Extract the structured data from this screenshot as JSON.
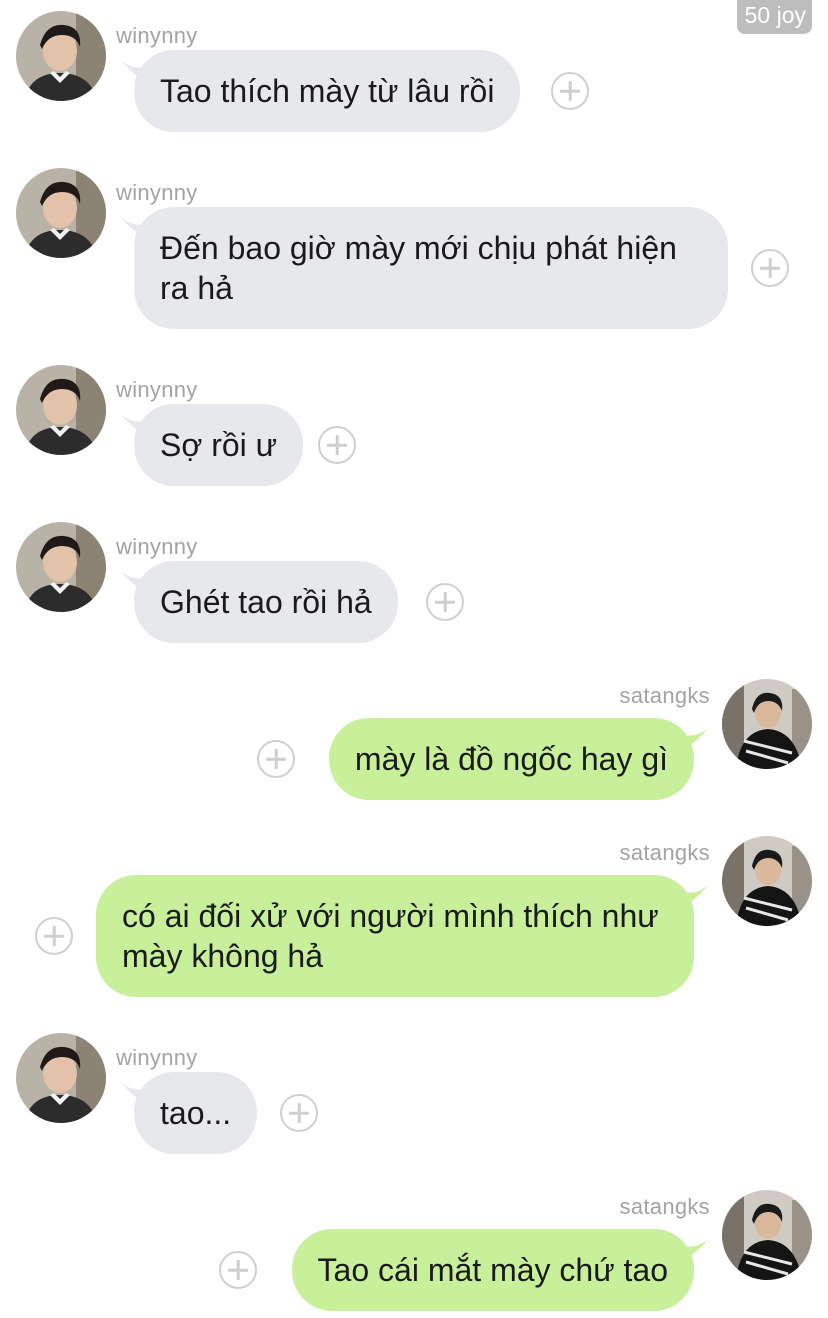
{
  "header": {
    "badge": "50 joy"
  },
  "users": {
    "left": {
      "name": "winynny",
      "avatar": "avatar-winynny"
    },
    "right": {
      "name": "satangks",
      "avatar": "avatar-satangks"
    }
  },
  "messages": [
    {
      "sender": "winynny",
      "side": "left",
      "text": "Tao thích mày từ lâu rồi"
    },
    {
      "sender": "winynny",
      "side": "left",
      "text": "Đến bao giờ mày mới chịu phát hiện ra hả"
    },
    {
      "sender": "winynny",
      "side": "left",
      "text": "Sợ rồi ư"
    },
    {
      "sender": "winynny",
      "side": "left",
      "text": "Ghét tao rồi hả"
    },
    {
      "sender": "satangks",
      "side": "right",
      "text": "mày là đồ ngốc hay gì"
    },
    {
      "sender": "satangks",
      "side": "right",
      "text": "có ai đối xử với người mình thích như mày không hả"
    },
    {
      "sender": "winynny",
      "side": "left",
      "text": "tao..."
    },
    {
      "sender": "satangks",
      "side": "right",
      "text": "Tao cái mắt mày chứ tao"
    }
  ],
  "colors": {
    "incoming_bubble": "#e6e8ec",
    "outgoing_bubble": "#c8ef9a",
    "name_text": "#a3a3a3",
    "badge_bg": "#bdbdbd"
  },
  "icons": {
    "react": "plus-circle-icon"
  }
}
